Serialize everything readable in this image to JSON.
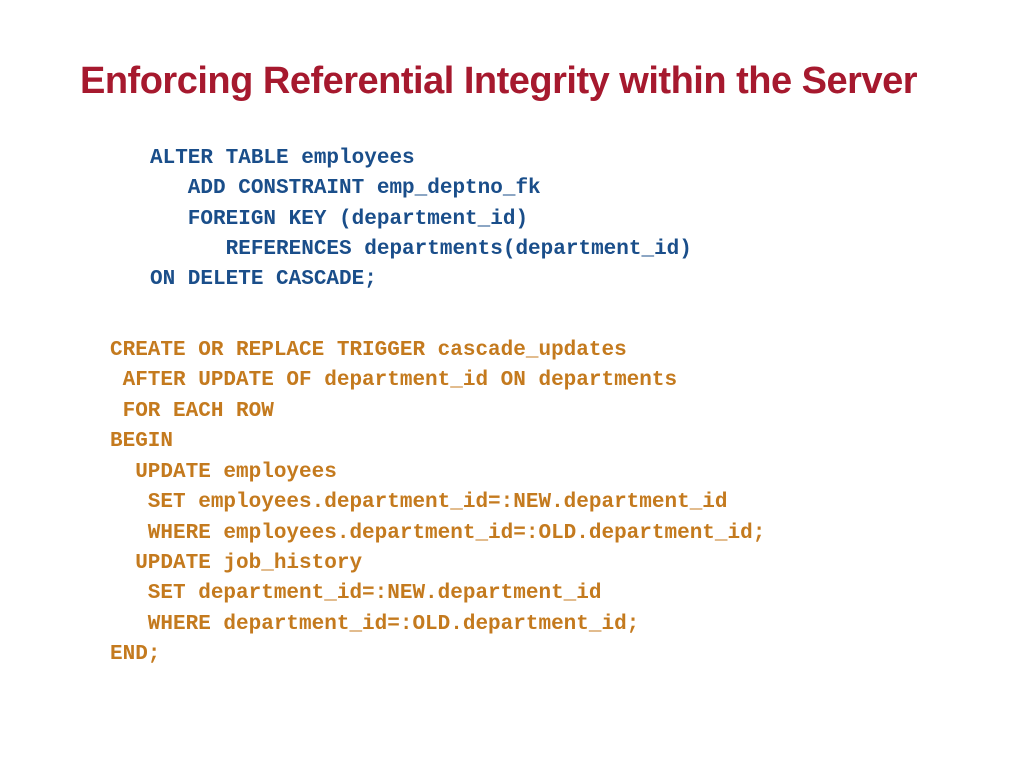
{
  "title": "Enforcing Referential Integrity within the Server",
  "code_block_1": "ALTER TABLE employees\n   ADD CONSTRAINT emp_deptno_fk\n   FOREIGN KEY (department_id)\n      REFERENCES departments(department_id)\nON DELETE CASCADE;",
  "code_block_2": "CREATE OR REPLACE TRIGGER cascade_updates\n AFTER UPDATE OF department_id ON departments\n FOR EACH ROW\nBEGIN\n  UPDATE employees\n   SET employees.department_id=:NEW.department_id\n   WHERE employees.department_id=:OLD.department_id;\n  UPDATE job_history\n   SET department_id=:NEW.department_id\n   WHERE department_id=:OLD.department_id;\nEND;"
}
